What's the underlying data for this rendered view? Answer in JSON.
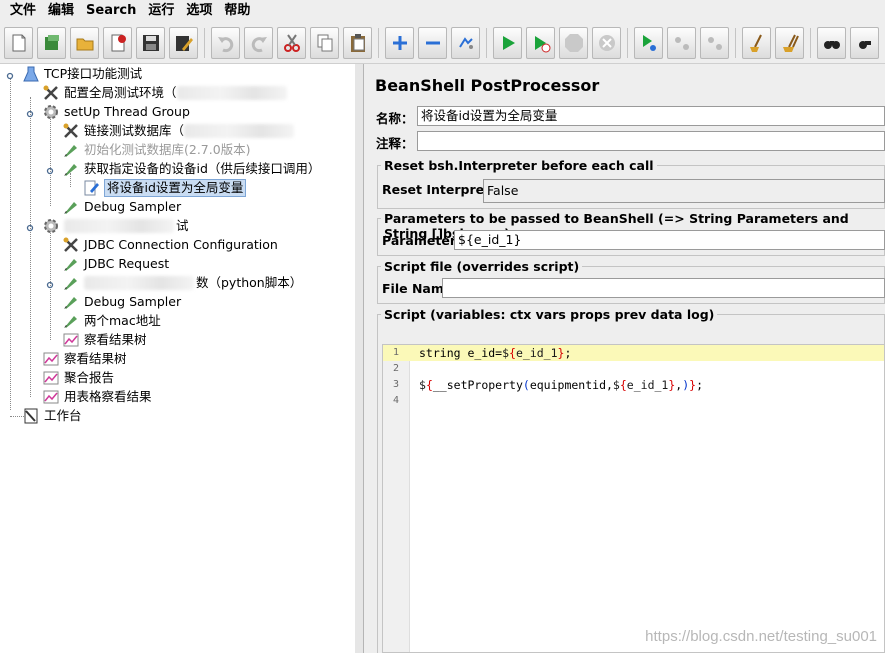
{
  "menu": [
    "文件",
    "编辑",
    "Search",
    "运行",
    "选项",
    "帮助"
  ],
  "toolbar": {
    "buttons": [
      {
        "icon": "new-icon",
        "color": "#ffffff"
      },
      {
        "icon": "templates-icon",
        "color": "#3a8a3a"
      },
      {
        "icon": "open-icon",
        "color": "#d9a12a"
      },
      {
        "icon": "close-file-icon",
        "color": "#cc2222"
      },
      {
        "icon": "save-icon",
        "color": "#333333"
      },
      {
        "icon": "save-as-icon",
        "color": "#b07a20"
      },
      {
        "icon": "undo-icon",
        "color": "#bbbbbb"
      },
      {
        "icon": "redo-icon",
        "color": "#bbbbbb"
      },
      {
        "icon": "cut-icon",
        "color": "#cc2222"
      },
      {
        "icon": "copy-icon",
        "color": "#777777"
      },
      {
        "icon": "paste-icon",
        "color": "#8a6a3a"
      },
      {
        "icon": "expand-icon",
        "color": "#2a6fd6"
      },
      {
        "icon": "collapse-icon",
        "color": "#2a6fd6"
      },
      {
        "icon": "toggle-icon",
        "color": "#2a6fd6"
      },
      {
        "icon": "start-icon",
        "color": "#1aa33a"
      },
      {
        "icon": "start-no-timers-icon",
        "color": "#1aa33a"
      },
      {
        "icon": "stop-icon",
        "color": "#bbbbbb"
      },
      {
        "icon": "shutdown-icon",
        "color": "#bbbbbb"
      },
      {
        "icon": "remote-start-icon",
        "color": "#1aa33a"
      },
      {
        "icon": "remote-stop-icon",
        "color": "#bbbbbb"
      },
      {
        "icon": "remote-shutdown-icon",
        "color": "#bbbbbb"
      },
      {
        "icon": "clear-icon",
        "color": "#b07a20"
      },
      {
        "icon": "clear-all-icon",
        "color": "#b07a20"
      },
      {
        "icon": "search-icon",
        "color": "#222222"
      },
      {
        "icon": "reset-search-icon",
        "color": "#222222"
      }
    ]
  },
  "tree": [
    {
      "label": "TCP接口功能测试",
      "icon": "test-plan-icon",
      "indent": 0,
      "toggle": true
    },
    {
      "label": "配置全局测试环境（",
      "icon": "config-element-icon",
      "indent": 1,
      "blurred": true
    },
    {
      "label": "setUp Thread Group",
      "icon": "thread-group-icon",
      "indent": 1,
      "toggle": true
    },
    {
      "label": "链接测试数据库（",
      "icon": "config-element-icon",
      "indent": 2,
      "blurred": true
    },
    {
      "label": "初始化测试数据库(2.7.0版本)",
      "icon": "sampler-icon",
      "indent": 2,
      "disabled": true
    },
    {
      "label": "获取指定设备的设备id（供后续接口调用）",
      "icon": "sampler-icon",
      "indent": 2,
      "toggle": true
    },
    {
      "label": "将设备id设置为全局变量",
      "icon": "postprocessor-icon",
      "indent": 3,
      "selected": true
    },
    {
      "label": "Debug Sampler",
      "icon": "sampler-icon",
      "indent": 2
    },
    {
      "label": "试",
      "icon": "thread-group-icon",
      "indent": 1,
      "toggle": true,
      "blurredPrefix": true
    },
    {
      "label": "JDBC Connection Configuration",
      "icon": "config-element-icon",
      "indent": 2
    },
    {
      "label": "JDBC Request",
      "icon": "sampler-icon",
      "indent": 2
    },
    {
      "label": "数（python脚本）",
      "icon": "sampler-icon",
      "indent": 2,
      "toggle": true,
      "blurredPrefix": true
    },
    {
      "label": "Debug Sampler",
      "icon": "sampler-icon",
      "indent": 2
    },
    {
      "label": "两个mac地址",
      "icon": "sampler-icon",
      "indent": 2
    },
    {
      "label": "察看结果树",
      "icon": "listener-icon",
      "indent": 2
    },
    {
      "label": "察看结果树",
      "icon": "listener-icon",
      "indent": 1
    },
    {
      "label": "聚合报告",
      "icon": "listener-icon",
      "indent": 1
    },
    {
      "label": "用表格察看结果",
      "icon": "listener-icon",
      "indent": 1
    },
    {
      "label": "工作台",
      "icon": "workbench-icon",
      "indent": 0
    }
  ],
  "panel": {
    "title": "BeanShell PostProcessor",
    "name_label": "名称：",
    "name_value": "将设备id设置为全局变量",
    "comment_label": "注释：",
    "comment_value": "",
    "reset_group_title": "Reset bsh.Interpreter before each call",
    "reset_label": "Reset Interpreter:",
    "reset_value": "False",
    "params_group_title": "Parameters to be passed to BeanShell (=> String Parameters and String []bsh.args)",
    "params_label": "Parameters:",
    "params_value": "${e_id_1}",
    "file_group_title": "Script file (overrides script)",
    "file_label": "File Name:",
    "file_value": "",
    "script_group_title": "Script (variables: ctx vars props prev data log)"
  },
  "script": {
    "line_numbers": [
      "1",
      "2",
      "3",
      "4"
    ],
    "line1_a": "string e_id=",
    "line1_dollar": "$",
    "line1_lbrace": "{",
    "line1_inner": "e_id_1",
    "line1_rbrace": "}",
    "line1_end": ";",
    "line3_dollar": "$",
    "line3_lbrace": "{",
    "line3_fn": "__setProperty",
    "line3_lparen": "(",
    "line3_args": "equipmentid,",
    "line3_dollar2": "$",
    "line3_lbrace2": "{",
    "line3_inner": "e_id_1",
    "line3_rbrace2": "}",
    "line3_comma": ",",
    "line3_rparen": ")",
    "line3_rbrace": "}",
    "line3_end": ";"
  },
  "watermark": "https://blog.csdn.net/testing_su001"
}
